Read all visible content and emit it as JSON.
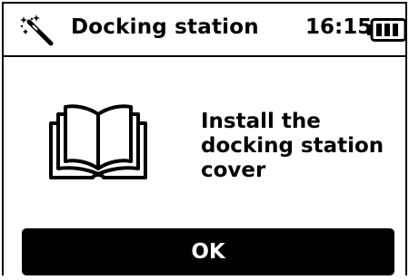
{
  "header": {
    "icon": "magic-wand-icon",
    "title": "Docking station",
    "time": "16:15",
    "battery_icon": "battery-full-icon"
  },
  "content": {
    "icon": "manual-book-icon",
    "message": "Install the\ndocking station\ncover"
  },
  "footer": {
    "ok_label": "OK"
  },
  "colors": {
    "background": "#ffffff",
    "foreground": "#000000",
    "button_background": "#000000",
    "button_text": "#ffffff"
  }
}
